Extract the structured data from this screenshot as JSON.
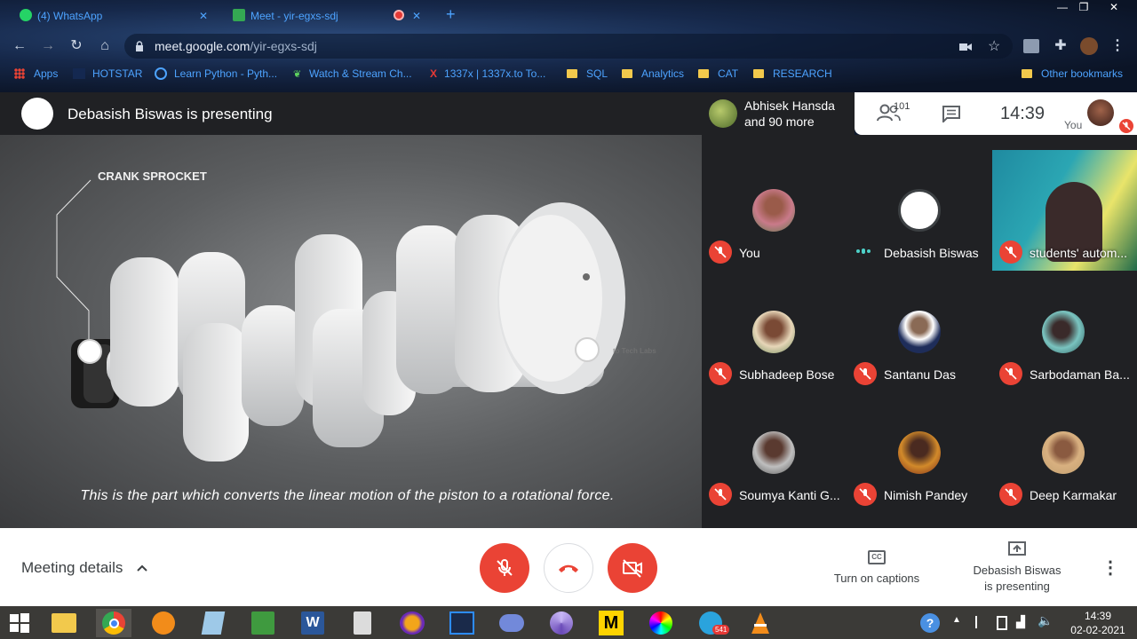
{
  "browser": {
    "tabs": [
      {
        "label": "(4) WhatsApp"
      },
      {
        "label": "Meet - yir-egxs-sdj"
      }
    ],
    "new_tab": "+",
    "window_controls": {
      "minimize": "—",
      "restore": "❐",
      "close": "✕"
    },
    "url_host": "meet.google.com",
    "url_path": "/yir-egxs-sdj",
    "bookmarks": [
      {
        "label": "Apps"
      },
      {
        "label": "HOTSTAR"
      },
      {
        "label": "Learn Python - Pyth..."
      },
      {
        "label": "Watch & Stream Ch..."
      },
      {
        "label": "1337x | 1337x.to To..."
      },
      {
        "label": "SQL"
      },
      {
        "label": "Analytics"
      },
      {
        "label": "CAT"
      },
      {
        "label": "RESEARCH"
      }
    ],
    "other_bookmarks": "Other bookmarks",
    "profile_badge": "↓"
  },
  "meet": {
    "presenting_title": "Debasish Biswas is presenting",
    "header": {
      "participants_summary_line1": "Abhisek Hansda",
      "participants_summary_line2": "and 90 more",
      "participant_count": "101",
      "time": "14:39",
      "you_label": "You"
    },
    "presentation": {
      "label_crank": "CRANK SPROCKET",
      "watermark": "to Tech Labs",
      "caption": "This is the part which converts the linear motion of the piston to a rotational force."
    },
    "tiles": [
      {
        "name": "You"
      },
      {
        "name": "Debasish Biswas"
      },
      {
        "name": "students' autom..."
      },
      {
        "name": "Subhadeep Bose"
      },
      {
        "name": "Santanu Das"
      },
      {
        "name": "Sarbodaman Ba..."
      },
      {
        "name": "Soumya Kanti G..."
      },
      {
        "name": "Nimish Pandey"
      },
      {
        "name": "Deep Karmakar"
      }
    ],
    "bottom": {
      "meeting_details": "Meeting details",
      "captions_label": "Turn on captions",
      "cc": "CC",
      "presenting_line1": "Debasish Biswas",
      "presenting_line2": "is presenting"
    }
  },
  "taskbar": {
    "apps": [
      "start",
      "file-explorer",
      "chrome",
      "fl-studio",
      "notepad",
      "excel",
      "word",
      "calculator",
      "headphones",
      "zoom",
      "discord",
      "browser",
      "m-app",
      "color",
      "telegram",
      "vlc"
    ],
    "telegram_badge": "541",
    "time": "14:39",
    "date": "02-02-2021"
  },
  "colors": {
    "meet_red": "#ea4335",
    "link_blue": "#4da3ff",
    "dark_panel": "#202124"
  }
}
